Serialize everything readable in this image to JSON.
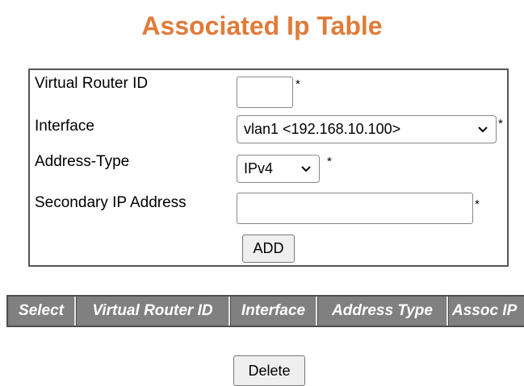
{
  "page_title": "Associated Ip Table",
  "form": {
    "vrid": {
      "label": "Virtual Router ID",
      "value": "",
      "required_mark": "*"
    },
    "interface": {
      "label": "Interface",
      "selected": "vlan1 <192.168.10.100>",
      "required_mark": "*"
    },
    "address_type": {
      "label": "Address-Type",
      "selected": "IPv4",
      "required_mark": "*"
    },
    "secondary_ip": {
      "label": "Secondary IP Address",
      "value": "",
      "required_mark": "*"
    },
    "add_label": "ADD"
  },
  "table": {
    "headers": [
      "Select",
      "Virtual Router ID",
      "Interface",
      "Address Type",
      "Assoc IP"
    ]
  },
  "delete_label": "Delete",
  "colors": {
    "title": "#e07b39",
    "table_header_bg": "#808080",
    "table_header_text": "#ffffff"
  }
}
